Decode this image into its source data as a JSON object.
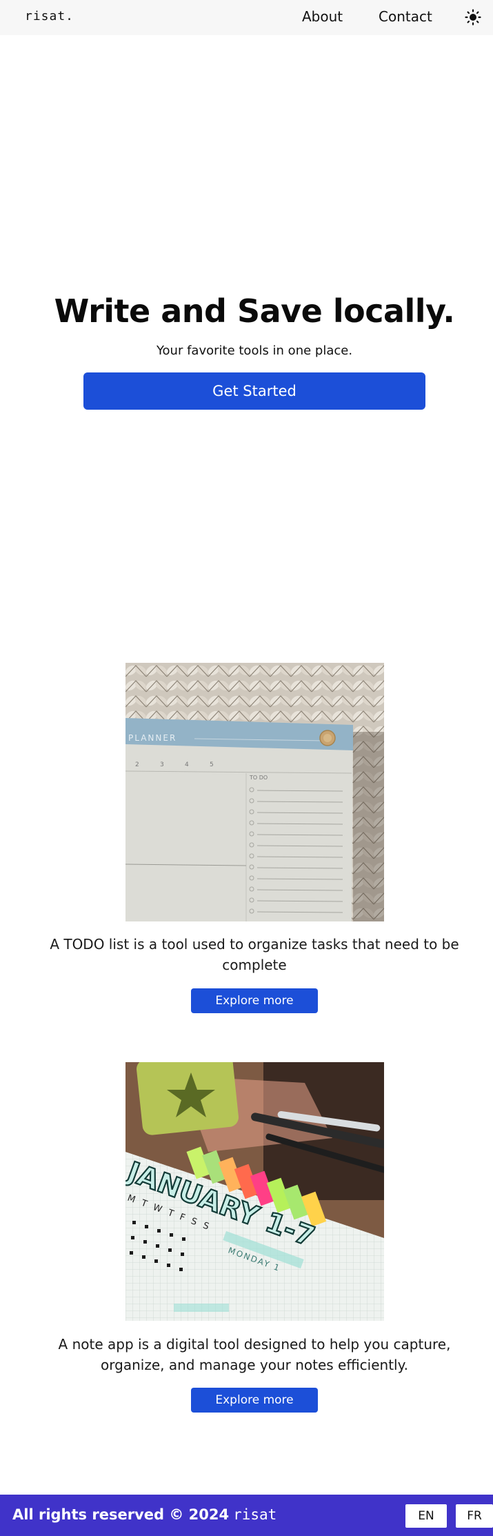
{
  "header": {
    "logo": "risat.",
    "nav": [
      {
        "label": "About"
      },
      {
        "label": "Contact"
      }
    ],
    "theme_icon": "sun-icon"
  },
  "hero": {
    "title": "Write and Save locally.",
    "subtitle": "Your favorite tools in one place.",
    "cta_label": "Get Started"
  },
  "features": [
    {
      "image_icon": "planner-photo",
      "description": "A TODO list is a tool used to organize tasks that need to be complete",
      "button_label": "Explore more",
      "image_text": {
        "planner": "PLANNER",
        "todo": "TO DO",
        "days": [
          "2",
          "3",
          "4",
          "5"
        ]
      }
    },
    {
      "image_icon": "calendar-notes-photo",
      "description": "A note app is a digital tool designed to help you capture, organize, and manage your notes efficiently.",
      "button_label": "Explore more",
      "image_text": {
        "month": "JANUARY 1-7",
        "weekdays": "M T W T F S S",
        "day": "MONDAY 1"
      }
    }
  ],
  "footer": {
    "copyright": "All rights reserved © 2024",
    "brand": "risat",
    "languages": [
      {
        "label": "EN"
      },
      {
        "label": "FR"
      }
    ]
  },
  "colors": {
    "primary": "#1c4fd8",
    "footer_bg": "#4033c9",
    "header_bg": "#f7f7f7"
  }
}
